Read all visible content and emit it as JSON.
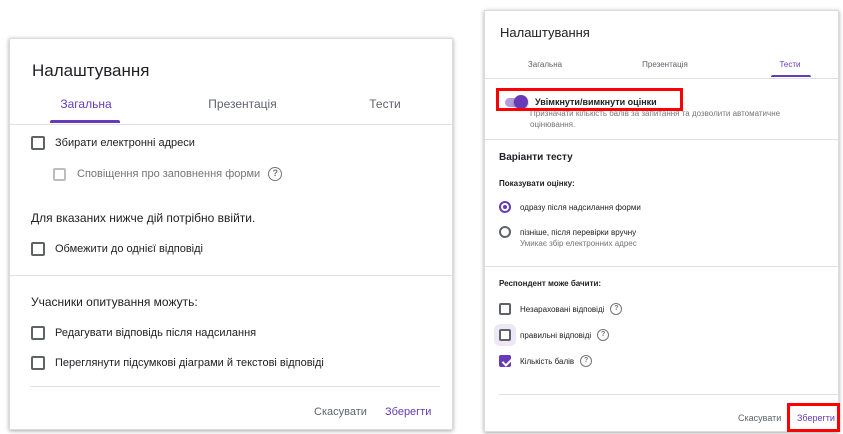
{
  "left_dialog": {
    "title": "Налаштування",
    "tabs": [
      {
        "label": "Загальна",
        "active": true
      },
      {
        "label": "Презентація",
        "active": false
      },
      {
        "label": "Тести",
        "active": false
      }
    ],
    "collect_emails": "Збирати електронні адреси",
    "notify_submit": "Сповіщення про заповнення форми",
    "requires_login_heading": "Для вказаних нижче дій потрібно ввійти.",
    "limit_one": "Обмежити до однієї відповіді",
    "respondents_heading": "Учасники опитування можуть:",
    "edit_after": "Редагувати відповідь після надсилання",
    "view_summary": "Переглянути підсумкові діаграми й текстові відповіді",
    "cancel": "Скасувати",
    "save": "Зберегти",
    "help_glyph": "?"
  },
  "right_dialog": {
    "title": "Налаштування",
    "tabs": [
      {
        "label": "Загальна",
        "active": false
      },
      {
        "label": "Презентація",
        "active": false
      },
      {
        "label": "Тести",
        "active": true
      }
    ],
    "toggle_label": "Увімкнути/вимкнути оцінки",
    "toggle_sub_1": "Призначати кількість балів за запитання та дозволити автоматичне",
    "toggle_sub_2": "оцінювання.",
    "quiz_options": "Варіанти тесту",
    "show_grade": "Показувати оцінку:",
    "option_immediate": "одразу після надсилання форми",
    "option_later": "пізніше, після перевірки вручну",
    "option_later_note": "Умикає збір електронних адрес",
    "respondent_can_see": "Респондент може бачити:",
    "missed": "Незараховані відповіді",
    "correct": "правильні відповіді",
    "points": "Кількість балів",
    "cancel": "Скасувати",
    "save": "Зберегти",
    "help_glyph": "?"
  },
  "colors": {
    "accent": "#673ab7",
    "highlight": "#ff0000",
    "text": "#202124",
    "muted": "#5f6368"
  }
}
